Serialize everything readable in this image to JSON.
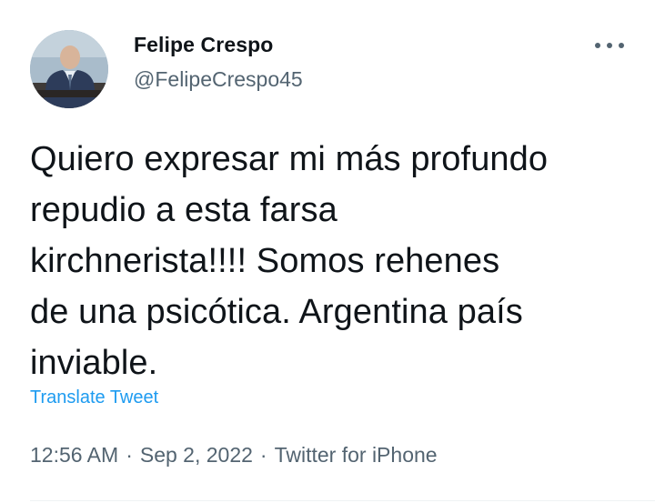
{
  "author": {
    "display_name": "Felipe Crespo",
    "handle": "@FelipeCrespo45"
  },
  "more_icon": "more-horizontal-icon",
  "tweet": {
    "lines": [
      "Quiero expresar mi más profundo",
      "repudio a esta farsa",
      "kirchnerista!!!! Somos rehenes",
      "de una psicótica. Argentina país",
      "inviable."
    ],
    "translate_label": "Translate Tweet"
  },
  "meta": {
    "time": "12:56 AM",
    "date": "Sep 2, 2022",
    "source": "Twitter for iPhone",
    "separator": "·"
  },
  "colors": {
    "text_primary": "#0f1419",
    "text_secondary": "#536471",
    "link": "#1d9bf0",
    "divider": "#eff3f4"
  }
}
